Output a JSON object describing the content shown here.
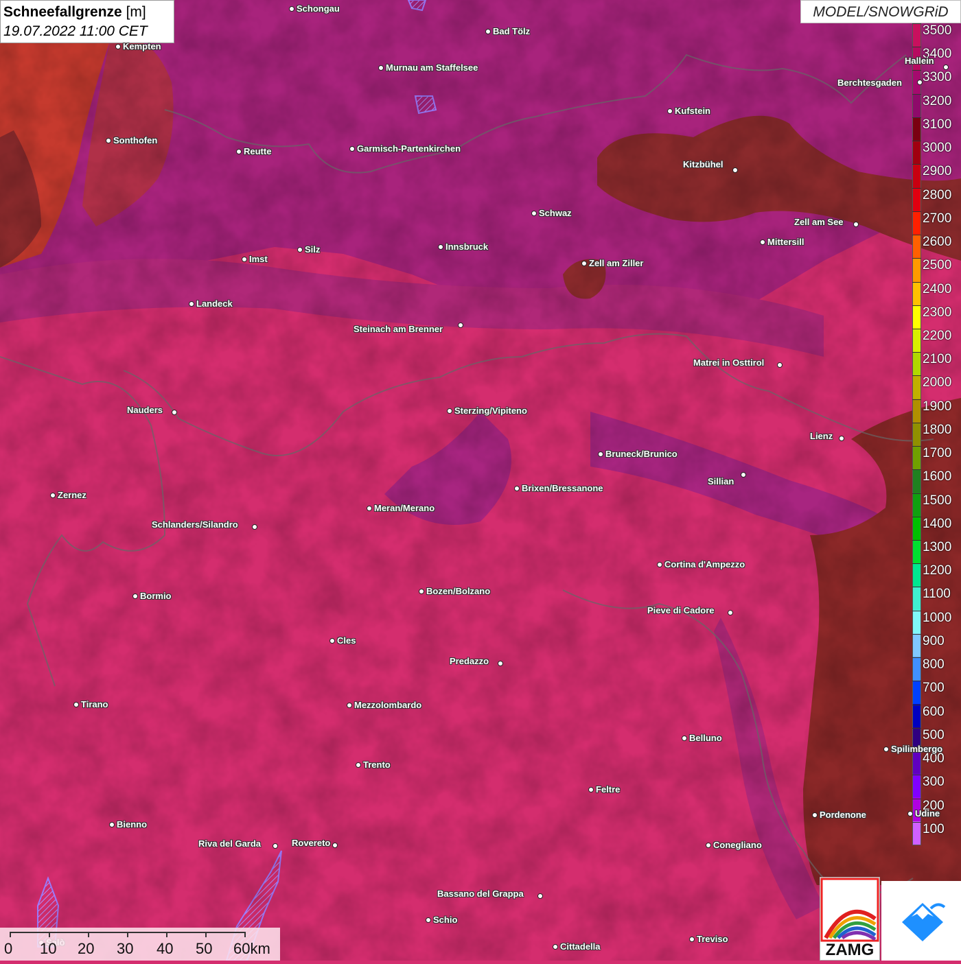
{
  "header": {
    "title_bold": "Schneefallgrenze",
    "title_unit": "[m]",
    "timestamp": "19.07.2022 11:00 CET",
    "model": "MODEL/SNOWGRiD"
  },
  "legend": {
    "unit": "m",
    "values": [
      3500,
      3400,
      3300,
      3200,
      3100,
      3000,
      2900,
      2800,
      2700,
      2600,
      2500,
      2400,
      2300,
      2200,
      2100,
      2000,
      1900,
      1800,
      1700,
      1600,
      1500,
      1400,
      1300,
      1200,
      1100,
      1000,
      900,
      800,
      700,
      600,
      500,
      400,
      300,
      200,
      100
    ],
    "labels": [
      "3500",
      "3400",
      "3300",
      "3200",
      "3100",
      "3000",
      "2900",
      "2800",
      "2700",
      "2600",
      "2500",
      "2400",
      "2300",
      "2200",
      "2100",
      "2000",
      "1900",
      "1800",
      "1700",
      "1600",
      "1500",
      "1400",
      "1300",
      "1200",
      "1100",
      "1000",
      "900",
      "800",
      "700",
      "600",
      "500",
      "400",
      "300",
      "200",
      "100"
    ],
    "colors": [
      "#c8105e",
      "#b80a60",
      "#a50a6e",
      "#8e0a6a",
      "#7a0010",
      "#a00010",
      "#c80010",
      "#e00010",
      "#ff2000",
      "#ff6000",
      "#ff9a00",
      "#ffc000",
      "#ffff00",
      "#d8f000",
      "#b0d800",
      "#c0b000",
      "#b09000",
      "#909000",
      "#70a000",
      "#208020",
      "#10a010",
      "#00c000",
      "#00e030",
      "#00e890",
      "#40f0d0",
      "#80f8f8",
      "#80c8ff",
      "#4090ff",
      "#0040ff",
      "#0000c0",
      "#300080",
      "#6000c0",
      "#8000ff",
      "#b000e0",
      "#d060ff"
    ]
  },
  "cities": [
    {
      "name": "Schongau",
      "label_side": "right"
    },
    {
      "name": "Bad Tölz",
      "label_side": "right"
    },
    {
      "name": "Kempten",
      "label_side": "right"
    },
    {
      "name": "Murnau am Staffelsee",
      "label_side": "right"
    },
    {
      "name": "Hallein",
      "label_side": "left"
    },
    {
      "name": "Berchtesgaden",
      "label_side": "left"
    },
    {
      "name": "Kufstein",
      "label_side": "right"
    },
    {
      "name": "Sonthofen",
      "label_side": "right"
    },
    {
      "name": "Reutte",
      "label_side": "right"
    },
    {
      "name": "Garmisch-Partenkirchen",
      "label_side": "right"
    },
    {
      "name": "Kitzbühel",
      "label_side": "left"
    },
    {
      "name": "Schwaz",
      "label_side": "right"
    },
    {
      "name": "Zell am See",
      "label_side": "left"
    },
    {
      "name": "Mittersill",
      "label_side": "right"
    },
    {
      "name": "Innsbruck",
      "label_side": "right"
    },
    {
      "name": "Silz",
      "label_side": "right"
    },
    {
      "name": "Imst",
      "label_side": "right"
    },
    {
      "name": "Zell am Ziller",
      "label_side": "right"
    },
    {
      "name": "Landeck",
      "label_side": "right"
    },
    {
      "name": "Steinach am Brenner",
      "label_side": "left"
    },
    {
      "name": "Matrei in Osttirol",
      "label_side": "left"
    },
    {
      "name": "Nauders",
      "label_side": "left"
    },
    {
      "name": "Sterzing/Vipiteno",
      "label_side": "right"
    },
    {
      "name": "Lienz",
      "label_side": "left"
    },
    {
      "name": "Bruneck/Brunico",
      "label_side": "right"
    },
    {
      "name": "Sillian",
      "label_side": "left"
    },
    {
      "name": "Brixen/Bressanone",
      "label_side": "right"
    },
    {
      "name": "Zernez",
      "label_side": "right"
    },
    {
      "name": "Meran/Merano",
      "label_side": "right"
    },
    {
      "name": "Schlanders/Silandro",
      "label_side": "left"
    },
    {
      "name": "Cortina d'Ampezzo",
      "label_side": "right"
    },
    {
      "name": "Bozen/Bolzano",
      "label_side": "right"
    },
    {
      "name": "Bormio",
      "label_side": "right"
    },
    {
      "name": "Pieve di Cadore",
      "label_side": "left"
    },
    {
      "name": "Cles",
      "label_side": "right"
    },
    {
      "name": "Predazzo",
      "label_side": "left"
    },
    {
      "name": "Tirano",
      "label_side": "right"
    },
    {
      "name": "Mezzolombardo",
      "label_side": "right"
    },
    {
      "name": "Belluno",
      "label_side": "right"
    },
    {
      "name": "Spilimbergo",
      "label_side": "right"
    },
    {
      "name": "Trento",
      "label_side": "right"
    },
    {
      "name": "Feltre",
      "label_side": "right"
    },
    {
      "name": "Pordenone",
      "label_side": "right"
    },
    {
      "name": "Udine",
      "label_side": "right"
    },
    {
      "name": "Bienno",
      "label_side": "right"
    },
    {
      "name": "Riva del Garda",
      "label_side": "left"
    },
    {
      "name": "Rovereto",
      "label_side": "left"
    },
    {
      "name": "Conegliano",
      "label_side": "right"
    },
    {
      "name": "Bassano del Grappa",
      "label_side": "left"
    },
    {
      "name": "Schio",
      "label_side": "right"
    },
    {
      "name": "Salò",
      "label_side": "right"
    },
    {
      "name": "Treviso",
      "label_side": "right"
    },
    {
      "name": "Cittadella",
      "label_side": "right"
    }
  ],
  "scale": {
    "labels": [
      "0",
      "10",
      "20",
      "30",
      "40",
      "50",
      "60km"
    ]
  },
  "logos": {
    "zamg": "ZAMG"
  }
}
